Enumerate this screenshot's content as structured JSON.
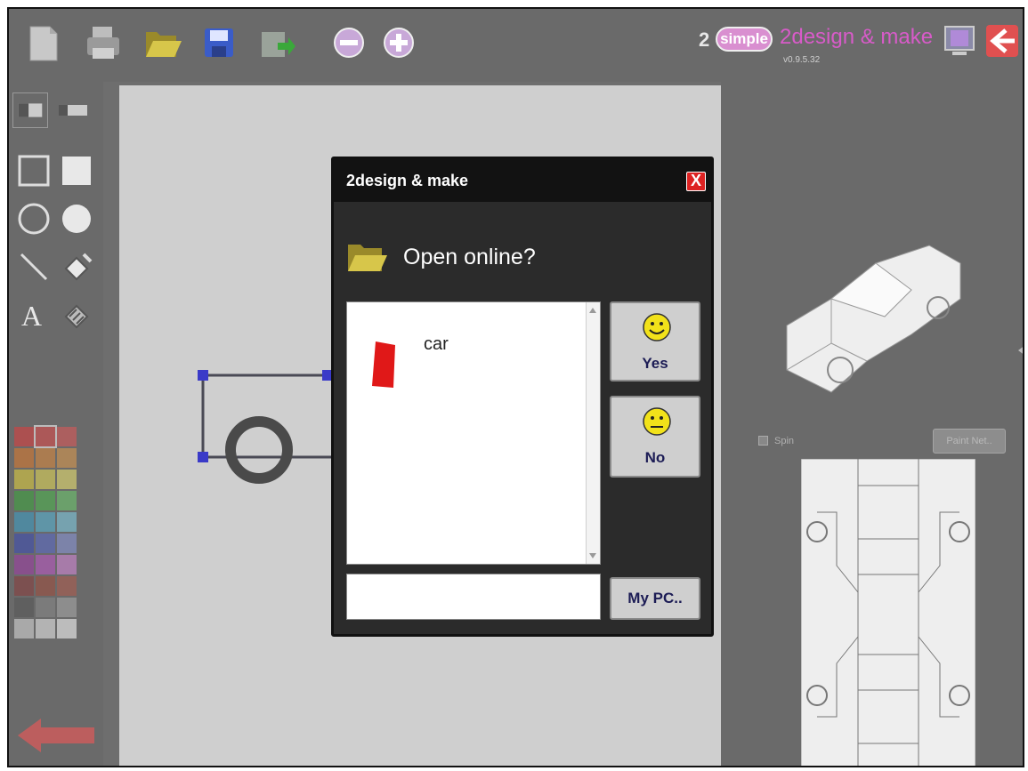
{
  "app": {
    "brand_prefix": "2",
    "brand_pill": "simple",
    "title": "2design & make",
    "version": "v0.9.5.32"
  },
  "toolbar": {
    "icons": [
      "new-icon",
      "print-icon",
      "open-folder-icon",
      "save-icon",
      "export-icon",
      "zoom-out-icon",
      "zoom-in-icon",
      "fullscreen-icon",
      "exit-icon"
    ]
  },
  "right_panel": {
    "spin_label": "Spin",
    "paint_net_label": "Paint Net.."
  },
  "palette": {
    "colors": [
      [
        "#e23b3b",
        "#e24a4a",
        "#e25555"
      ],
      [
        "#e07a2a",
        "#e08a3a",
        "#e09a4a"
      ],
      [
        "#e6d43a",
        "#eadf55",
        "#f0e870"
      ],
      [
        "#3aa83a",
        "#4ab84a",
        "#6ccc6c"
      ],
      [
        "#3aa0c8",
        "#55b8d8",
        "#7fd0e8"
      ],
      [
        "#3a4ab8",
        "#5a6acc",
        "#8a98dd"
      ],
      [
        "#a03aa8",
        "#c055c8",
        "#d888dd"
      ],
      [
        "#8a3a3a",
        "#a04a3a",
        "#b05a4a"
      ],
      [
        "#555555",
        "#888888",
        "#aaaaaa"
      ],
      [
        "#dddddd",
        "#eeeeee",
        "#ffffff"
      ]
    ]
  },
  "dialog": {
    "title": "2design & make",
    "close_symbol": "X",
    "question": "Open online?",
    "files": [
      {
        "name": "car",
        "thumb_color": "#e01818"
      }
    ],
    "yes_label": "Yes",
    "no_label": "No",
    "filename_value": "",
    "my_pc_label": "My PC.."
  }
}
